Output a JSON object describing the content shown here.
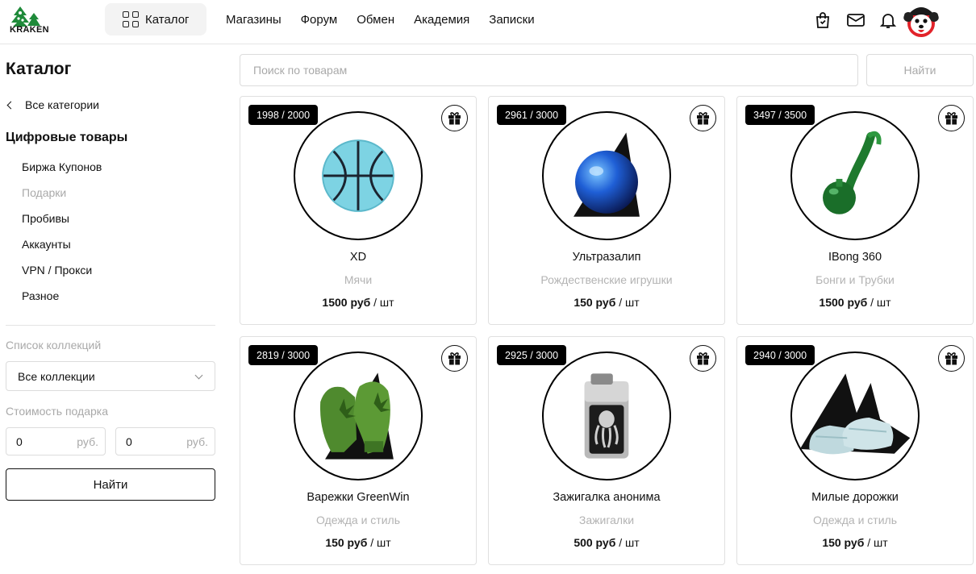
{
  "header": {
    "logo_text": "KRAKEN",
    "catalog_label": "Каталог",
    "nav": [
      "Магазины",
      "Форум",
      "Обмен",
      "Академия",
      "Записки"
    ]
  },
  "sidebar": {
    "title": "Каталог",
    "back_label": "Все категории",
    "category_heading": "Цифровые товары",
    "categories": [
      {
        "label": "Биржа Купонов",
        "muted": false
      },
      {
        "label": "Подарки",
        "muted": true
      },
      {
        "label": "Пробивы",
        "muted": false
      },
      {
        "label": "Аккаунты",
        "muted": false
      },
      {
        "label": "VPN / Прокси",
        "muted": false
      },
      {
        "label": "Разное",
        "muted": false
      }
    ],
    "collections_label": "Список коллекций",
    "collections_value": "Все коллекции",
    "gift_cost_label": "Стоимость подарка",
    "price_from": "0",
    "price_to": "0",
    "price_unit": "руб.",
    "find_button": "Найти"
  },
  "search": {
    "placeholder": "Поиск по товарам",
    "button": "Найти"
  },
  "products": [
    {
      "badge": "1998 / 2000",
      "name": "XD",
      "category": "Мячи",
      "price": "1500 руб",
      "unit": " / шт",
      "image": "basketball"
    },
    {
      "badge": "2961 / 3000",
      "name": "Ультразалип",
      "category": "Рождественские игрушки",
      "price": "150 руб",
      "unit": " / шт",
      "image": "blue-ornament"
    },
    {
      "badge": "3497 / 3500",
      "name": "IBong 360",
      "category": "Бонги и Трубки",
      "price": "1500 руб",
      "unit": " / шт",
      "image": "green-bong"
    },
    {
      "badge": "2819 / 3000",
      "name": "Варежки GreenWin",
      "category": "Одежда и стиль",
      "price": "150 руб",
      "unit": " / шт",
      "image": "green-mittens"
    },
    {
      "badge": "2925 / 3000",
      "name": "Зажигалка анонима",
      "category": "Зажигалки",
      "price": "500 руб",
      "unit": " / шт",
      "image": "octopus-lighter"
    },
    {
      "badge": "2940 / 3000",
      "name": "Милые дорожки",
      "category": "Одежда и стиль",
      "price": "150 руб",
      "unit": " / шт",
      "image": "slippers"
    }
  ]
}
